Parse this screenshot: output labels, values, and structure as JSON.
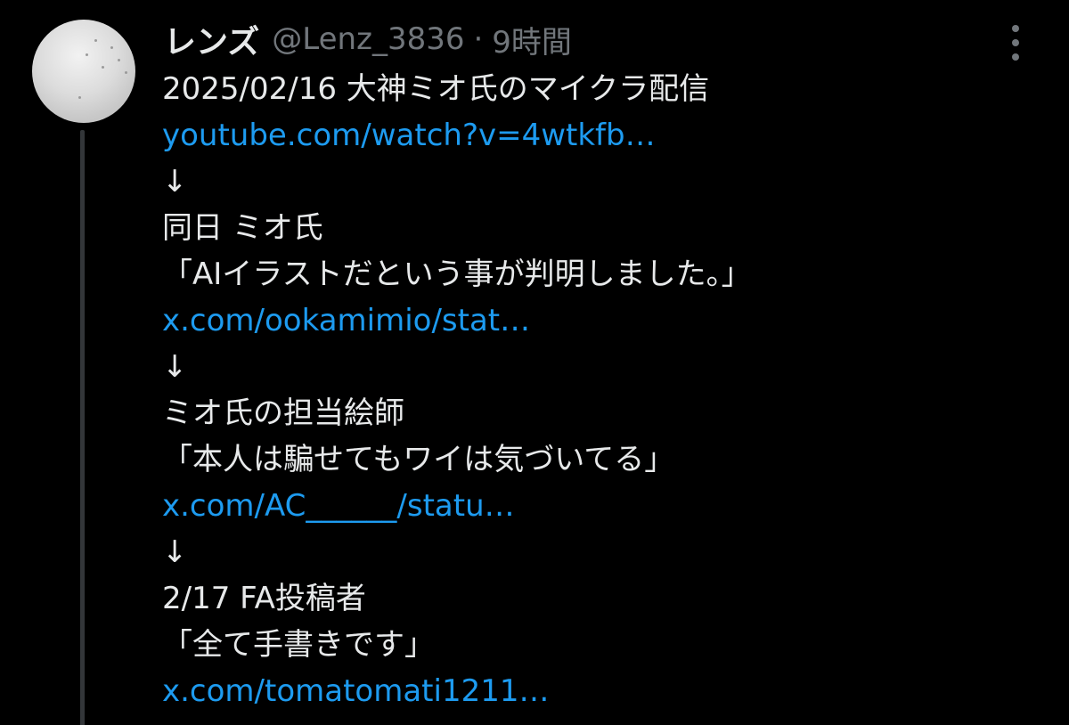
{
  "author": {
    "display_name": "レンズ",
    "handle": "@Lenz_3836",
    "separator": "·",
    "time": "9時間"
  },
  "colors": {
    "background": "#000000",
    "text": "#e7e9ea",
    "muted": "#71767b",
    "link": "#1d9bf0"
  },
  "icons": {
    "more": "more-vertical-icon"
  },
  "tweet": {
    "lines": [
      {
        "text": "2025/02/16 大神ミオ氏のマイクラ配信",
        "type": "text"
      },
      {
        "text": "youtube.com/watch?v=4wtkfb…",
        "type": "link"
      },
      {
        "text": "↓",
        "type": "text"
      },
      {
        "text": "同日 ミオ氏",
        "type": "text"
      },
      {
        "text": "「AIイラストだという事が判明しました。」",
        "type": "text"
      },
      {
        "text": "x.com/ookamimio/stat…",
        "type": "link"
      },
      {
        "text": "↓",
        "type": "text"
      },
      {
        "text": "ミオ氏の担当絵師",
        "type": "text"
      },
      {
        "text": "「本人は騙せてもワイは気づいてる」",
        "type": "text"
      },
      {
        "text": "x.com/AC______/statu…",
        "type": "link"
      },
      {
        "text": "↓",
        "type": "text"
      },
      {
        "text": "2/17 FA投稿者",
        "type": "text"
      },
      {
        "text": "「全て手書きです」",
        "type": "text"
      },
      {
        "text": "x.com/tomatomati1211…",
        "type": "link"
      }
    ]
  }
}
